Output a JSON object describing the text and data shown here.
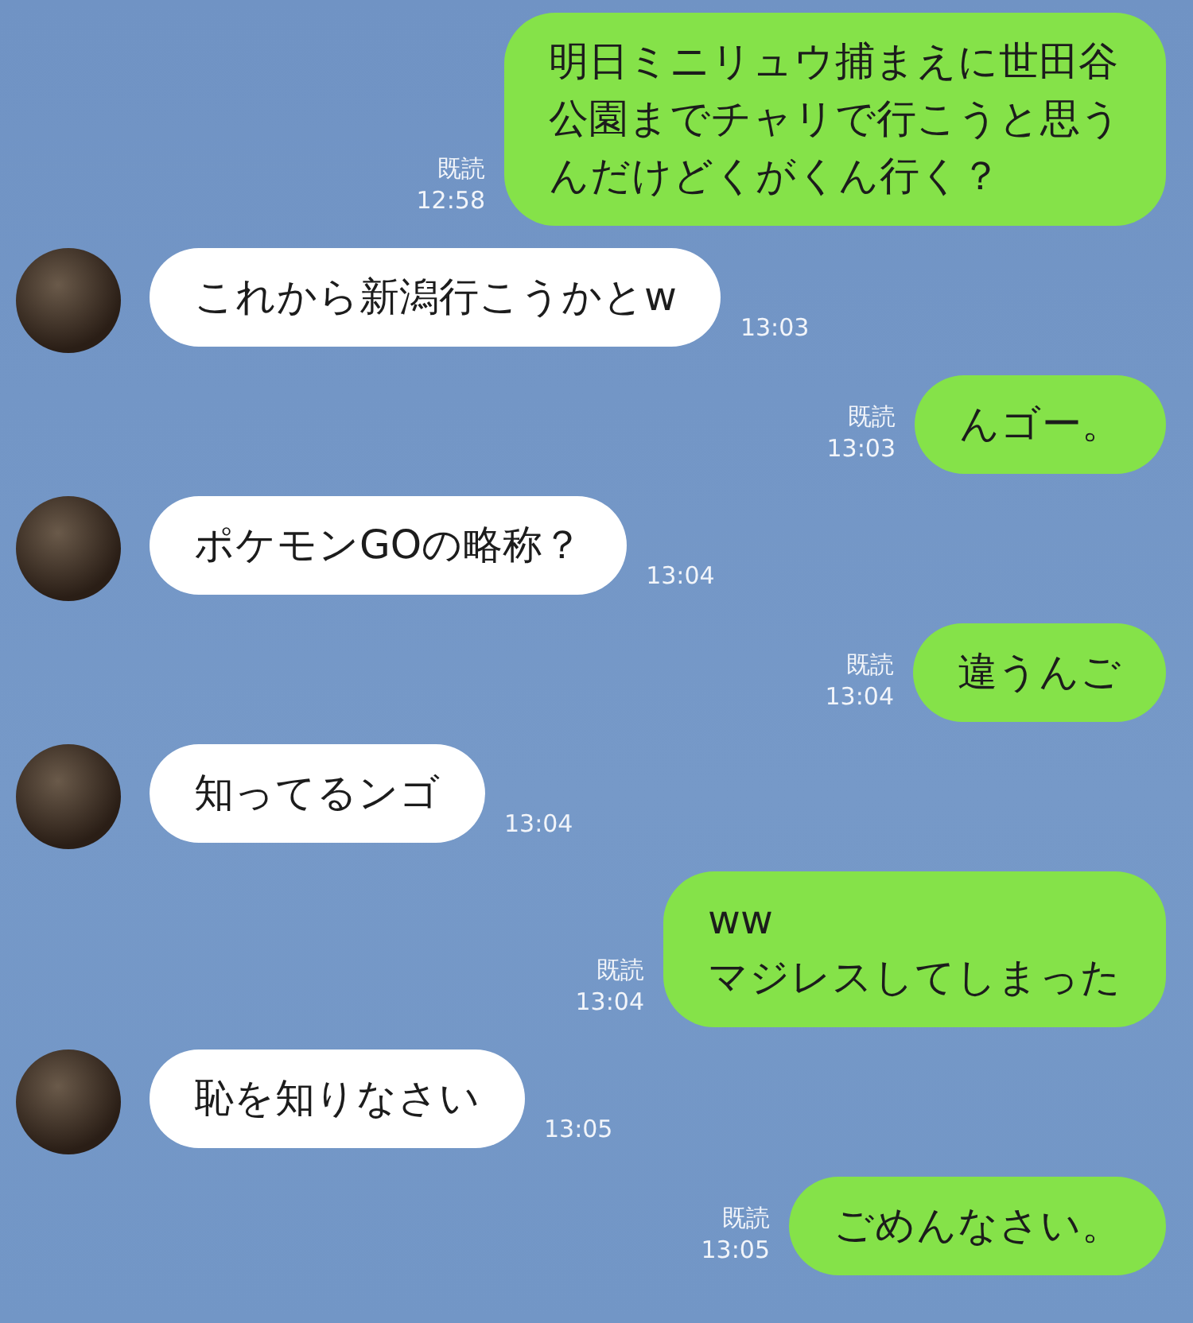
{
  "messages": [
    {
      "kind": "sent",
      "lines": [
        "明日ミニリュウ捕まえに世田谷",
        "公園までチャリで行こうと思う",
        "んだけどくがくん行く？"
      ],
      "read": "既読",
      "time": "12:58"
    },
    {
      "kind": "received",
      "lines": [
        "これから新潟行こうかとw"
      ],
      "time": "13:03"
    },
    {
      "kind": "sent",
      "lines": [
        "んゴー。"
      ],
      "read": "既読",
      "time": "13:03"
    },
    {
      "kind": "received",
      "lines": [
        "ポケモンGOの略称？"
      ],
      "time": "13:04"
    },
    {
      "kind": "sent",
      "lines": [
        "違うんご"
      ],
      "read": "既読",
      "time": "13:04"
    },
    {
      "kind": "received",
      "lines": [
        "知ってるンゴ"
      ],
      "time": "13:04"
    },
    {
      "kind": "sent",
      "lines": [
        "ww",
        "マジレスしてしまった"
      ],
      "read": "既読",
      "time": "13:04"
    },
    {
      "kind": "received",
      "lines": [
        "恥を知りなさい"
      ],
      "time": "13:05"
    },
    {
      "kind": "sent",
      "lines": [
        "ごめんなさい。"
      ],
      "read": "既読",
      "time": "13:05"
    }
  ]
}
